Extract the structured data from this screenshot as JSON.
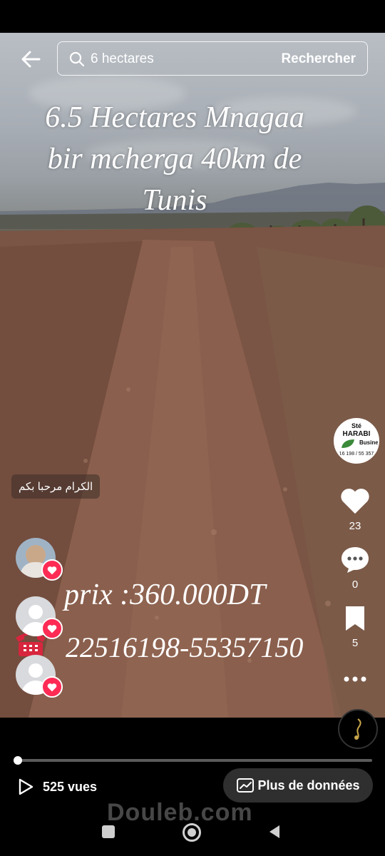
{
  "search": {
    "query": "6 hectares",
    "button_label": "Rechercher"
  },
  "overlay": {
    "title_lines": [
      "6.5 Hectares Mnagaa",
      "bir mcherga 40km de",
      "Tunis"
    ],
    "price": "prix :360.000DT",
    "phone": "22516198-55357150",
    "welcome": "الكرام مرحبا بكم"
  },
  "brand_avatar": {
    "line1": "Sté",
    "line2": "HARABI",
    "line3": "Business",
    "line4": "16 198 / 55 357"
  },
  "rail": {
    "likes": "23",
    "comments": "0",
    "saves": "5"
  },
  "footer": {
    "views": "525 vues",
    "more_data": "Plus de données",
    "watermark": "Douleb.com"
  },
  "progress": 0.005,
  "colors": {
    "accent_red": "#fe2c55",
    "overlay_text": "#ffffff"
  },
  "icons": [
    "back-arrow-icon",
    "search-icon",
    "heart-icon",
    "comment-icon",
    "bookmark-icon",
    "more-icon",
    "play-icon",
    "chart-icon",
    "telephone-icon",
    "music-disc-icon"
  ]
}
